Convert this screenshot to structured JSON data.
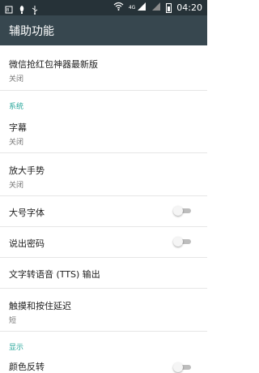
{
  "status_bar": {
    "left_icons": [
      "sim-icon",
      "notification-icon",
      "usb-icon"
    ],
    "network": "4G",
    "time": "04:20"
  },
  "toolbar": {
    "title": "辅助功能"
  },
  "items": [
    {
      "title": "微信抢红包神器最新版",
      "summary": "关闭"
    },
    {
      "title": "字幕",
      "summary": "关闭"
    },
    {
      "title": "放大手势",
      "summary": "关闭"
    },
    {
      "title": "大号字体",
      "switch": "off"
    },
    {
      "title": "说出密码",
      "switch": "off"
    },
    {
      "title": "文字转语音 (TTS) 输出"
    },
    {
      "title": "触摸和按住延迟",
      "summary": "短"
    },
    {
      "title": "颜色反转"
    }
  ],
  "section_headers": {
    "system": "系统",
    "display": "显示"
  },
  "colors": {
    "status_bar_bg": "#263238",
    "toolbar_bg": "#37474f",
    "accent": "#26a69a",
    "switch_off": "#bdbdbd"
  }
}
